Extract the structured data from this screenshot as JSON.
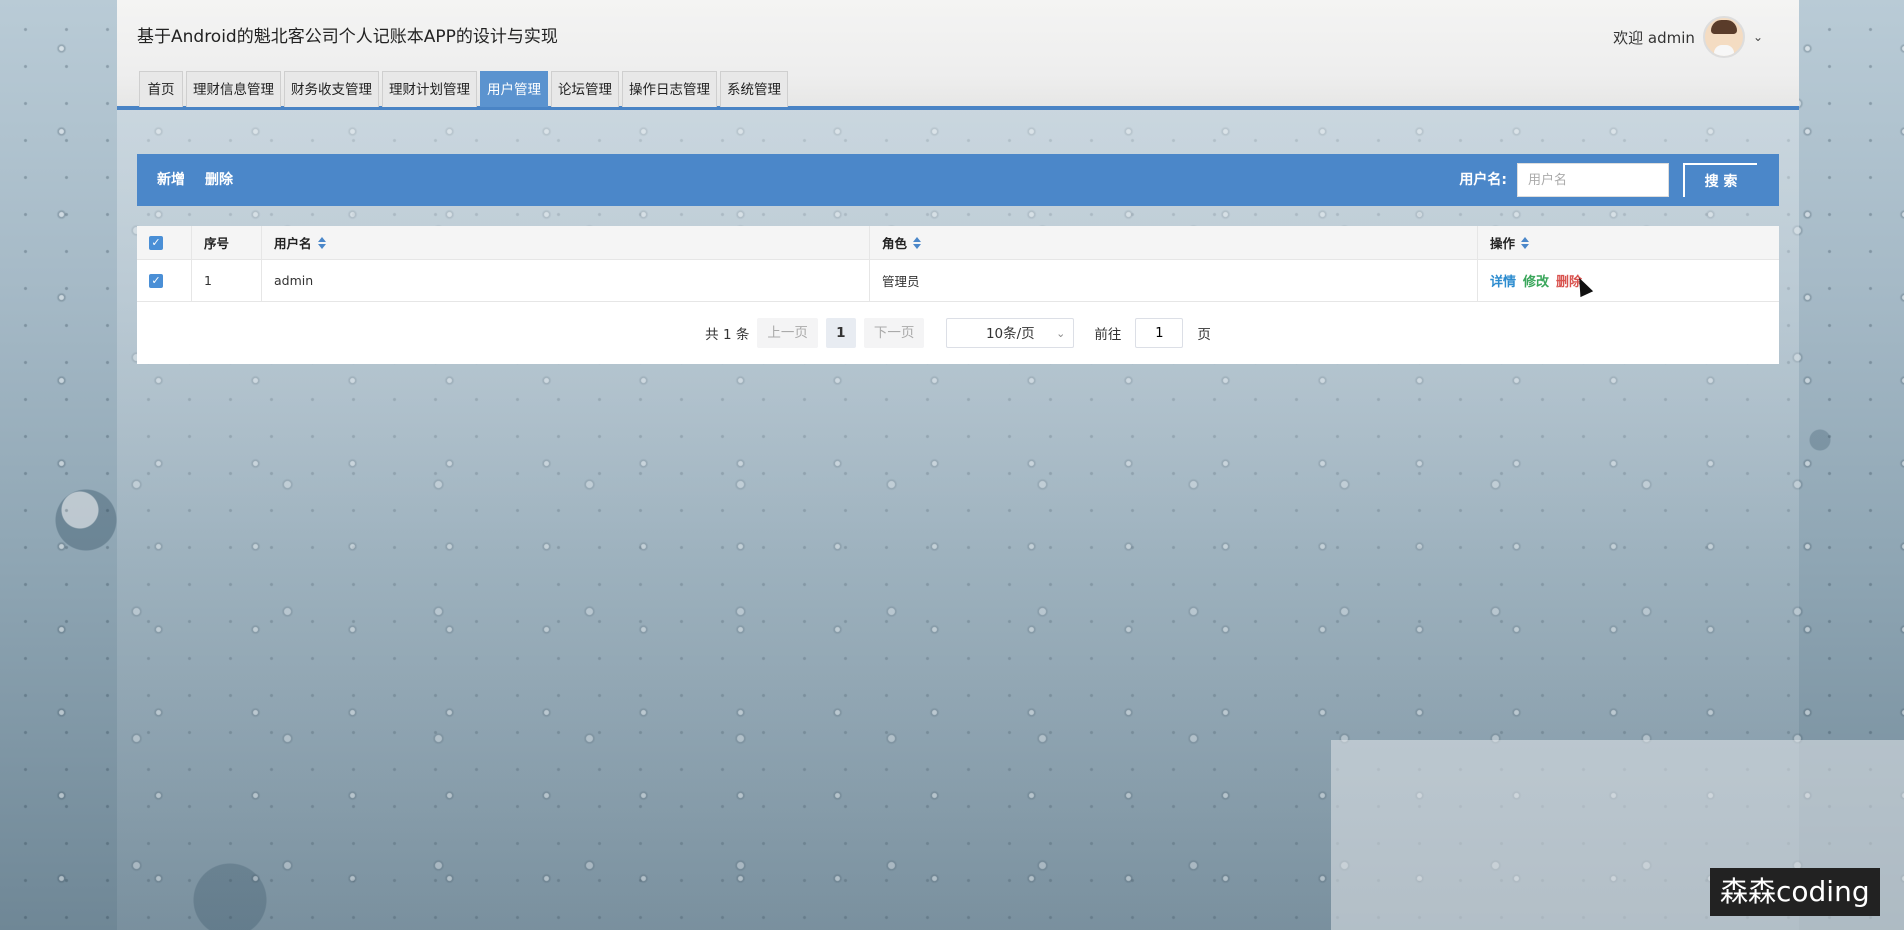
{
  "app": {
    "title": "基于Android的魁北客公司个人记账本APP的设计与实现"
  },
  "user": {
    "welcome": "欢迎 admin",
    "avatar_icon": "user-avatar",
    "dropdown_icon": "chevron-down-icon"
  },
  "nav": {
    "tabs": [
      {
        "label": "首页"
      },
      {
        "label": "理财信息管理"
      },
      {
        "label": "财务收支管理"
      },
      {
        "label": "理财计划管理"
      },
      {
        "label": "用户管理",
        "active": true
      },
      {
        "label": "论坛管理"
      },
      {
        "label": "操作日志管理"
      },
      {
        "label": "系统管理"
      }
    ]
  },
  "toolbar": {
    "add_label": "新增",
    "delete_label": "删除",
    "search_label": "用户名:",
    "search_placeholder": "用户名",
    "search_value": "",
    "search_button": "搜 索"
  },
  "table": {
    "headers": {
      "index": "序号",
      "username": "用户名",
      "role": "角色",
      "actions": "操作"
    },
    "rows": [
      {
        "index": "1",
        "username": "admin",
        "role": "管理员",
        "checked": true,
        "actions": {
          "detail": "详情",
          "edit": "修改",
          "delete": "删除"
        }
      }
    ]
  },
  "pagination": {
    "total": "共 1 条",
    "prev": "上一页",
    "current_page": "1",
    "next": "下一页",
    "page_size": "10条/页",
    "goto_label": "前往",
    "goto_value": "1",
    "page_suffix": "页"
  },
  "watermark": "森森coding",
  "colors": {
    "accent": "#4b87c9",
    "active_tab": "#5b93cf",
    "detail": "#2d8ccf",
    "edit": "#3aa65b",
    "delete": "#d9534f"
  }
}
